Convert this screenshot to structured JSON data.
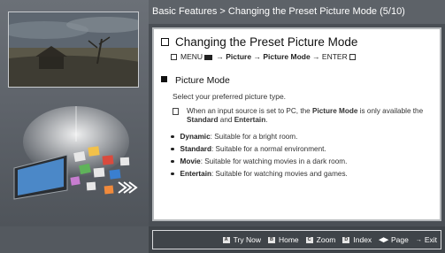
{
  "header": {
    "breadcrumb": "Basic Features > Changing the Preset Picture Mode (5/10)"
  },
  "content": {
    "title": "Changing the Preset Picture Mode",
    "menu_path": {
      "menu": "MENU",
      "arrow1": " → ",
      "item1": "Picture",
      "arrow2": " → ",
      "item2": "Picture Mode",
      "arrow3": " → ENTER"
    },
    "section_title": "Picture Mode",
    "description": "Select your preferred picture type.",
    "note": {
      "prefix": "When an input source is set to PC, the ",
      "bold1": "Picture Mode",
      "middle": " is only available the ",
      "bold2": "Standard",
      "and": " and ",
      "bold3": "Entertain",
      "end": "."
    },
    "bullets": [
      {
        "term": "Dynamic",
        "text": ": Suitable for a bright room."
      },
      {
        "term": "Standard",
        "text": ": Suitable for a normal environment."
      },
      {
        "term": "Movie",
        "text": ": Suitable for watching movies in a dark room."
      },
      {
        "term": "Entertain",
        "text": ": Suitable for watching movies and games."
      }
    ]
  },
  "bottom_nav": {
    "try_now": {
      "key": "A",
      "label": "Try Now"
    },
    "home": {
      "key": "B",
      "label": "Home"
    },
    "zoom": {
      "key": "C",
      "label": "Zoom"
    },
    "index": {
      "key": "D",
      "label": "Index"
    },
    "page": {
      "key": "◀▶",
      "label": "Page"
    },
    "exit": {
      "key": "→",
      "label": "Exit"
    }
  },
  "icons": {
    "photo": "landscape-photo",
    "tv_art": "tv-app-icons-art",
    "note": "note-icon",
    "menu": "menu-icon",
    "enter": "enter-icon"
  }
}
